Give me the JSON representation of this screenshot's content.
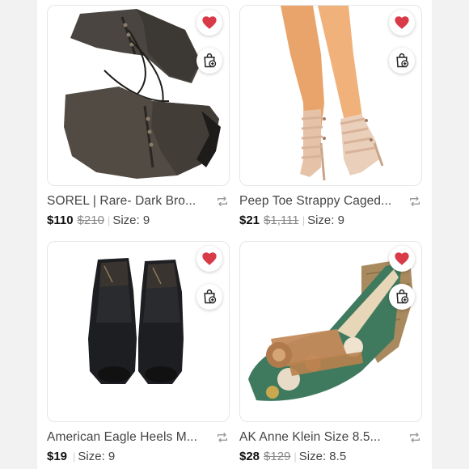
{
  "colors": {
    "heart": "#d93a48",
    "background": "#f2f2f2",
    "card": "#ffffff"
  },
  "listings": [
    {
      "title": "SOREL | Rare- Dark Bro...",
      "price": "$110",
      "original_price": "$210",
      "size": "Size: 9",
      "image": "dark-brown-lace-up-wedge-boots"
    },
    {
      "title": "Peep Toe Strappy Caged...",
      "price": "$21",
      "original_price": "$1,111",
      "size": "Size: 9",
      "image": "nude-caged-strappy-heels"
    },
    {
      "title": "American Eagle Heels M...",
      "price": "$19",
      "original_price": "",
      "size": "Size: 9",
      "image": "black-leather-peep-toe-mules"
    },
    {
      "title": "AK Anne Klein Size 8.5...",
      "price": "$28",
      "original_price": "$129",
      "size": "Size: 8.5",
      "image": "floral-espadrille-wedge-sandal"
    }
  ],
  "icons": {
    "like": "heart-icon",
    "bag": "shopping-bag-add-icon",
    "share": "repeat-icon"
  }
}
